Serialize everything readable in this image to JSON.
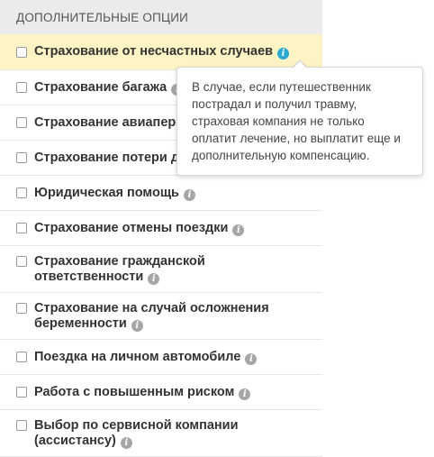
{
  "section": {
    "title": "Дополнительные опции"
  },
  "options": [
    {
      "label": "Страхование от несчастных случаев",
      "checked": false,
      "info_icon": "info-icon",
      "highlighted": true
    },
    {
      "label": "Страхование багажа",
      "checked": false,
      "info_icon": "info-icon"
    },
    {
      "label": "Страхование авиаперелета",
      "checked": false,
      "info_icon": "info-icon"
    },
    {
      "label": "Страхование потери документов",
      "checked": false,
      "info_icon": "info-icon"
    },
    {
      "label": "Юридическая помощь",
      "checked": false,
      "info_icon": "info-icon"
    },
    {
      "label": "Страхование отмены поездки",
      "checked": false,
      "info_icon": "info-icon"
    },
    {
      "label": "Страхование гражданской ответственности",
      "checked": false,
      "info_icon": "info-icon"
    },
    {
      "label": "Страхование на случай осложнения беременности",
      "checked": false,
      "info_icon": "info-icon"
    },
    {
      "label": "Поездка на личном автомобиле",
      "checked": false,
      "info_icon": "info-icon"
    },
    {
      "label": "Работа с повышенным риском",
      "checked": false,
      "info_icon": "info-icon"
    },
    {
      "label": "Выбор по сервисной компании (ассистансу)",
      "checked": false,
      "info_icon": "info-icon"
    }
  ],
  "tooltip": {
    "text": "В случае, если путешественник пострадал и получил травму, страховая компания не только оплатит лечение, но выплатит еще и дополнительную компенсацию."
  },
  "colors": {
    "highlight_row": "#fdf3c4",
    "info_active": "#2ca8d4",
    "info_inactive": "#a6a6a6",
    "header_bg": "#ebebeb"
  }
}
